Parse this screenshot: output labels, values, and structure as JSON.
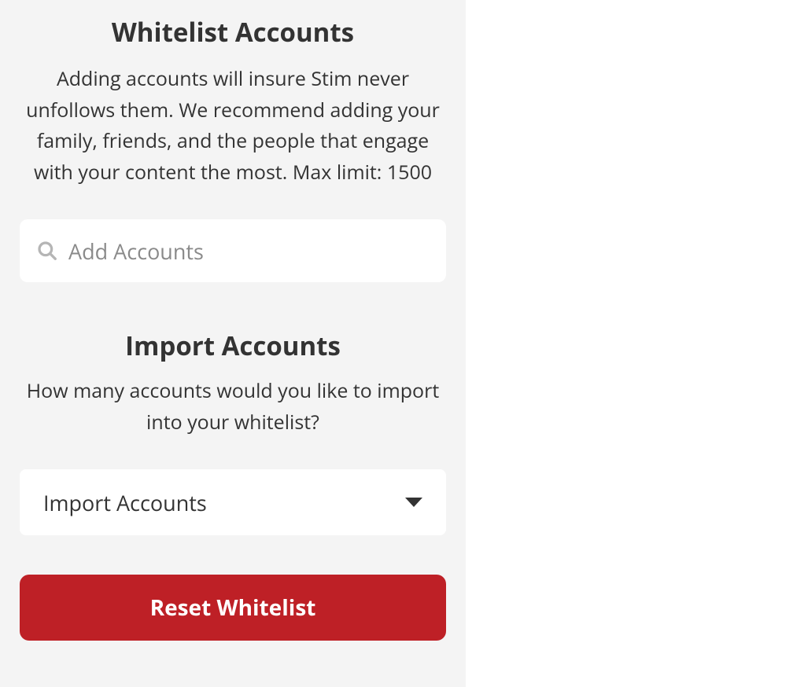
{
  "whitelist": {
    "title": "Whitelist Accounts",
    "description": "Adding accounts will insure Stim never unfollows them. We recommend adding your family, friends, and the people that engage with your content the most. Max limit: 1500",
    "input_placeholder": "Add Accounts"
  },
  "import": {
    "title": "Import Accounts",
    "description": "How many accounts would you like to import into your whitelist?",
    "select_value": "Import Accounts"
  },
  "reset_button_label": "Reset Whitelist",
  "colors": {
    "panel_bg": "#f4f4f4",
    "text": "#333333",
    "placeholder": "#8a8a8a",
    "danger": "#be2026",
    "white": "#ffffff"
  }
}
